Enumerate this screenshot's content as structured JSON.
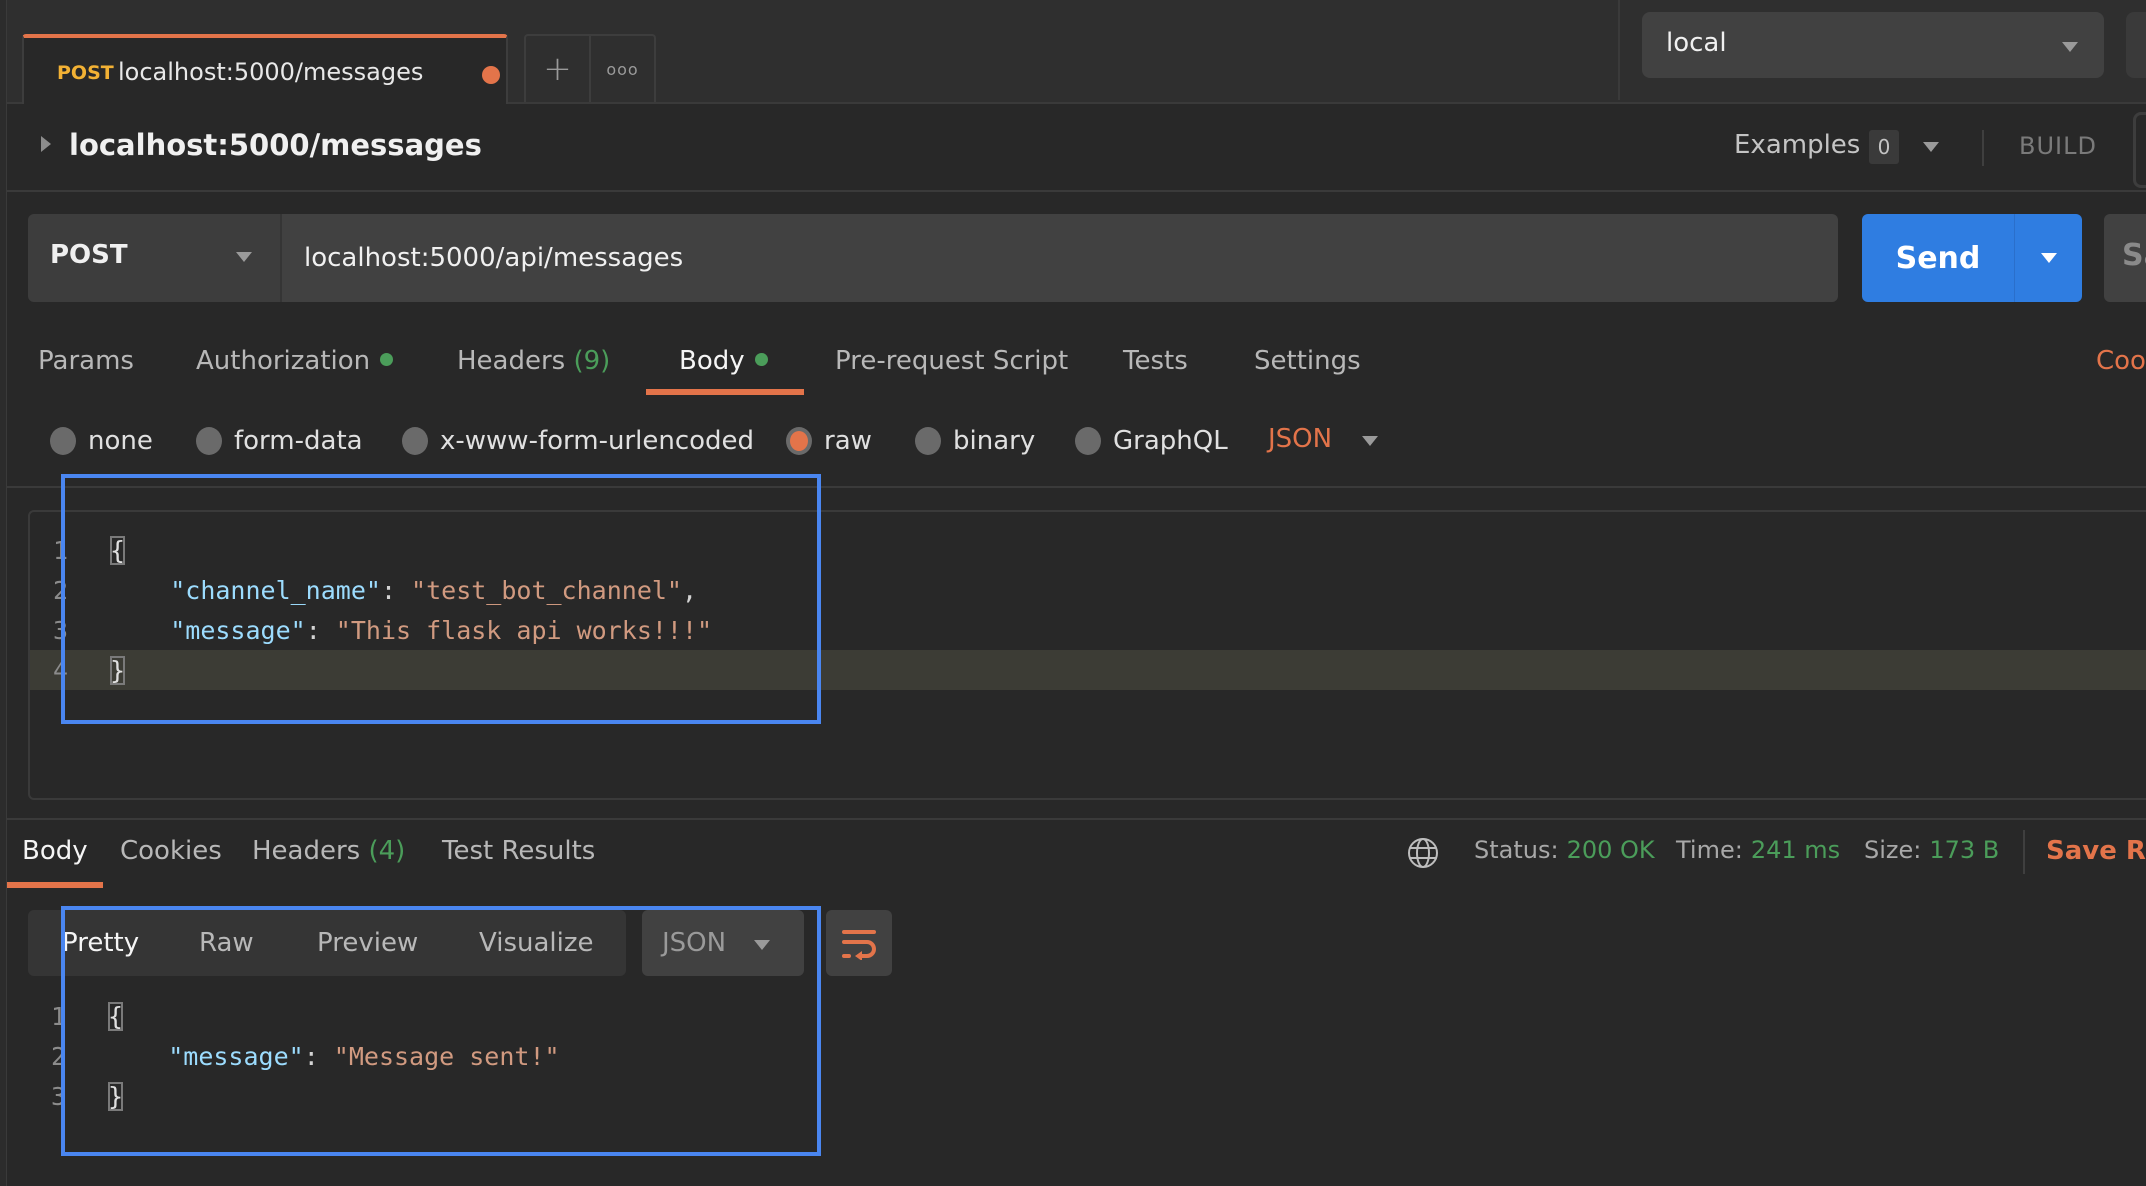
{
  "tab": {
    "method": "POST",
    "title": "localhost:5000/messages",
    "unsaved": true,
    "new_tab_icon": "plus-icon",
    "more_icon": "more-horizontal-icon"
  },
  "environment": {
    "selected": "local"
  },
  "request": {
    "name": "localhost:5000/messages",
    "examples_label": "Examples",
    "examples_count": "0",
    "mode_label": "BUILD",
    "method": "POST",
    "url": "localhost:5000/api/messages",
    "send_label": "Send",
    "save_label": "Sa"
  },
  "request_tabs": [
    {
      "label": "Params"
    },
    {
      "label": "Authorization",
      "dot": true
    },
    {
      "label": "Headers",
      "count": "(9)"
    },
    {
      "label": "Body",
      "dot": true,
      "active": true
    },
    {
      "label": "Pre-request Script"
    },
    {
      "label": "Tests"
    },
    {
      "label": "Settings"
    }
  ],
  "cookies_label": "Coo",
  "body_types": [
    {
      "label": "none",
      "checked": false
    },
    {
      "label": "form-data",
      "checked": false
    },
    {
      "label": "x-www-form-urlencoded",
      "checked": false
    },
    {
      "label": "raw",
      "checked": true
    },
    {
      "label": "binary",
      "checked": false
    },
    {
      "label": "GraphQL",
      "checked": false
    }
  ],
  "body_format": "JSON",
  "request_body": {
    "lines": [
      {
        "n": "1",
        "open": "{"
      },
      {
        "n": "2",
        "key": "\"channel_name\"",
        "colon": ": ",
        "value": "\"test_bot_channel\"",
        "trail": ","
      },
      {
        "n": "3",
        "key": "\"message\"",
        "colon": ": ",
        "value": "\"This flask api works!!!\"",
        "trail": ""
      },
      {
        "n": "4",
        "close": "}"
      }
    ]
  },
  "response_tabs": [
    {
      "label": "Body",
      "active": true
    },
    {
      "label": "Cookies"
    },
    {
      "label": "Headers",
      "count": "(4)"
    },
    {
      "label": "Test Results"
    }
  ],
  "response_meta": {
    "status_label": "Status:",
    "status_value": "200 OK",
    "time_label": "Time:",
    "time_value": "241 ms",
    "size_label": "Size:",
    "size_value": "173 B",
    "save_response_label": "Save Re"
  },
  "response_views": [
    "Pretty",
    "Raw",
    "Preview",
    "Visualize"
  ],
  "response_format": "JSON",
  "response_body": {
    "lines": [
      {
        "n": "1",
        "open": "{"
      },
      {
        "n": "2",
        "key": "\"message\"",
        "colon": ": ",
        "value": "\"Message sent!\""
      },
      {
        "n": "3",
        "close": "}"
      }
    ]
  },
  "colors": {
    "accent": "#e3744a",
    "send": "#2f7de1",
    "success": "#4b9d5a",
    "method_tab": "#f2b134",
    "highlight_box": "#4a86f0"
  }
}
